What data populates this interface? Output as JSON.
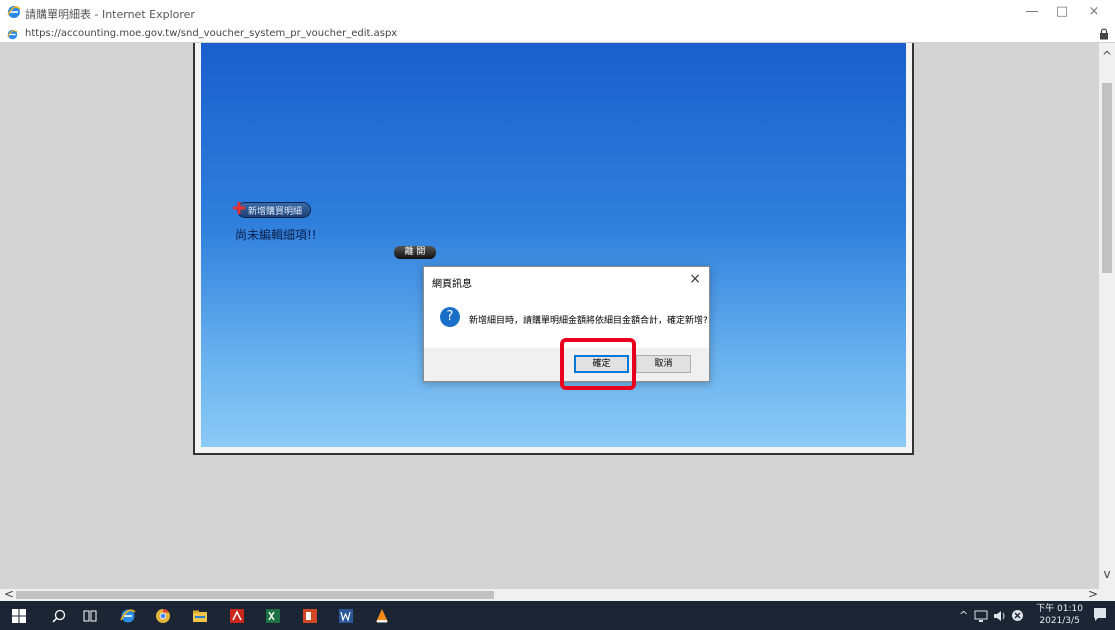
{
  "window": {
    "title": "請購單明細表 - Internet Explorer",
    "url": "https://accounting.moe.gov.tw/snd_voucher_system_pr_voucher_edit.aspx",
    "minimize": "—",
    "maximize": "□",
    "close": "×"
  },
  "page": {
    "add_item_label": "新增購買明細",
    "empty_message": "尚未編輯細項!!",
    "leave_button": "離 開"
  },
  "dialog": {
    "title": "網頁訊息",
    "close": "×",
    "icon": "?",
    "message": "新增細目時，請購單明細金額將依細目金額合計，確定新增?",
    "ok_label": "確定",
    "cancel_label": "取消"
  },
  "scrollbars": {
    "up": "^",
    "down": "v",
    "left": "<",
    "right": ">"
  },
  "taskbar": {
    "apps": [
      "windows-start",
      "search",
      "task-view",
      "internet-explorer",
      "chrome",
      "file-explorer",
      "acrobat",
      "excel",
      "powerpoint",
      "word",
      "vlc"
    ],
    "tray_caret": "^",
    "time": "下午 01:10",
    "date": "2021/3/5"
  },
  "colors": {
    "highlight": "#e8001c",
    "panel_top": "#1a5fcc",
    "panel_bottom": "#8ccaf6",
    "taskbar": "#1b2533"
  }
}
